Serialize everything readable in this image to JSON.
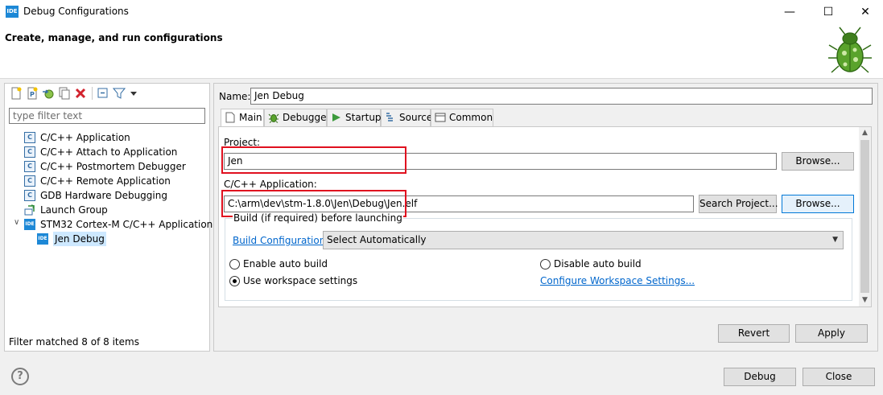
{
  "window": {
    "app_badge": "IDE",
    "title": "Debug Configurations",
    "minimize_glyph": "—",
    "maximize_glyph": "☐",
    "close_glyph": "✕"
  },
  "header": {
    "heading": "Create, manage, and run configurations",
    "icon": "bug-icon"
  },
  "toolbar": {
    "icons": [
      "new-configuration-icon",
      "new-prototype-icon",
      "export-icon",
      "duplicate-icon",
      "delete-icon",
      "collapse-all-icon",
      "filter-icon",
      "view-menu-icon"
    ]
  },
  "filter": {
    "placeholder": "type filter text",
    "status": "Filter matched 8 of 8 items"
  },
  "tree": {
    "items": [
      {
        "label": "C/C++ Application",
        "icon": "c-app-icon"
      },
      {
        "label": "C/C++ Attach to Application",
        "icon": "c-app-icon"
      },
      {
        "label": "C/C++ Postmortem Debugger",
        "icon": "c-app-icon"
      },
      {
        "label": "C/C++ Remote Application",
        "icon": "c-app-icon"
      },
      {
        "label": "GDB Hardware Debugging",
        "icon": "c-app-icon"
      },
      {
        "label": "Launch Group",
        "icon": "launch-group-icon"
      },
      {
        "label": "STM32 Cortex-M C/C++ Application",
        "icon": "ide-icon",
        "expanded": true
      },
      {
        "label": "Jen Debug",
        "icon": "ide-icon",
        "selected": true
      }
    ],
    "c_icon_glyph": "C",
    "ide_icon_glyph": "IDE",
    "expander_glyph": "∨"
  },
  "config": {
    "name_label": "Name:",
    "name_value": "Jen Debug",
    "tabs": [
      {
        "label": "Main",
        "icon": "main-tab-icon",
        "active": true
      },
      {
        "label": "Debugger",
        "icon": "debugger-tab-icon"
      },
      {
        "label": "Startup",
        "icon": "startup-tab-icon"
      },
      {
        "label": "Source",
        "icon": "source-tab-icon"
      },
      {
        "label": "Common",
        "icon": "common-tab-icon"
      }
    ],
    "project_label": "Project:",
    "project_value": "Jen",
    "project_browse": "Browse...",
    "application_label": "C/C++ Application:",
    "application_value": "C:\\arm\\dev\\stm-1.8.0\\Jen\\Debug\\Jen.elf",
    "search_project": "Search Project...",
    "application_browse": "Browse...",
    "build_group": {
      "title": "Build (if required) before launching",
      "build_config_link": "Build Configuration:",
      "build_config_value": "Select Automatically",
      "enable_auto_build": "Enable auto build",
      "disable_auto_build": "Disable auto build",
      "use_workspace_settings": "Use workspace settings",
      "configure_workspace_link": "Configure Workspace Settings...",
      "selected_option": "use_workspace_settings"
    },
    "revert": "Revert",
    "apply": "Apply"
  },
  "footer": {
    "help_glyph": "?",
    "debug": "Debug",
    "close": "Close"
  },
  "colors": {
    "highlight_box": "#e0101f",
    "link": "#0066cc",
    "selection": "#cde8ff",
    "accent": "#1d88d6"
  }
}
